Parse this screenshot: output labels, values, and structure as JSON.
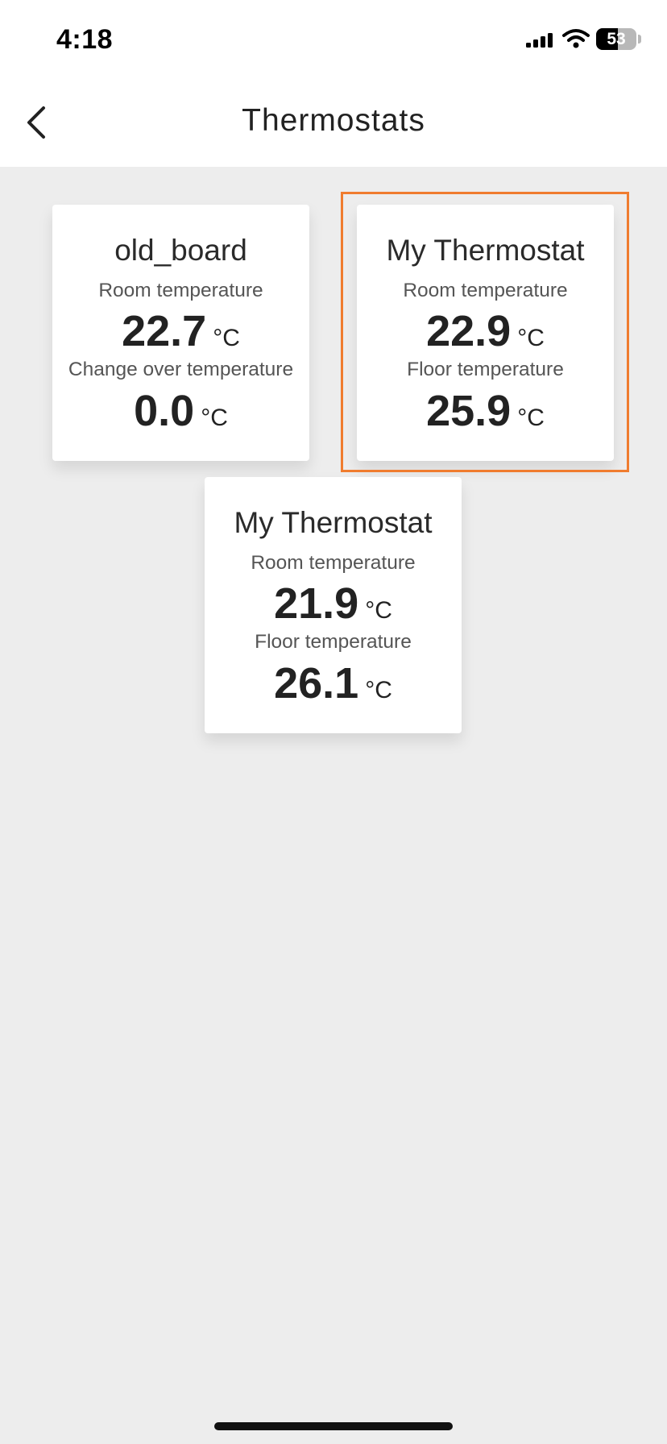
{
  "status_bar": {
    "time": "4:18",
    "battery": "53",
    "battery_level": 0.53
  },
  "nav": {
    "title": "Thermostats",
    "back_icon": "chevron-left-icon"
  },
  "colors": {
    "highlight": "#f07c2f",
    "background": "#ededed",
    "card": "#ffffff"
  },
  "thermostats": [
    {
      "name": "old_board",
      "label_1": "Room temperature",
      "value_1": "22.7",
      "unit_1": "°C",
      "label_2": "Change over temperature",
      "value_2": "0.0",
      "unit_2": "°C"
    },
    {
      "name": "My Thermostat",
      "label_1": "Room temperature",
      "value_1": "22.9",
      "unit_1": "°C",
      "label_2": "Floor temperature",
      "value_2": "25.9",
      "unit_2": "°C",
      "highlighted": true
    },
    {
      "name": "My Thermostat",
      "label_1": "Room temperature",
      "value_1": "21.9",
      "unit_1": "°C",
      "label_2": "Floor temperature",
      "value_2": "26.1",
      "unit_2": "°C"
    }
  ]
}
